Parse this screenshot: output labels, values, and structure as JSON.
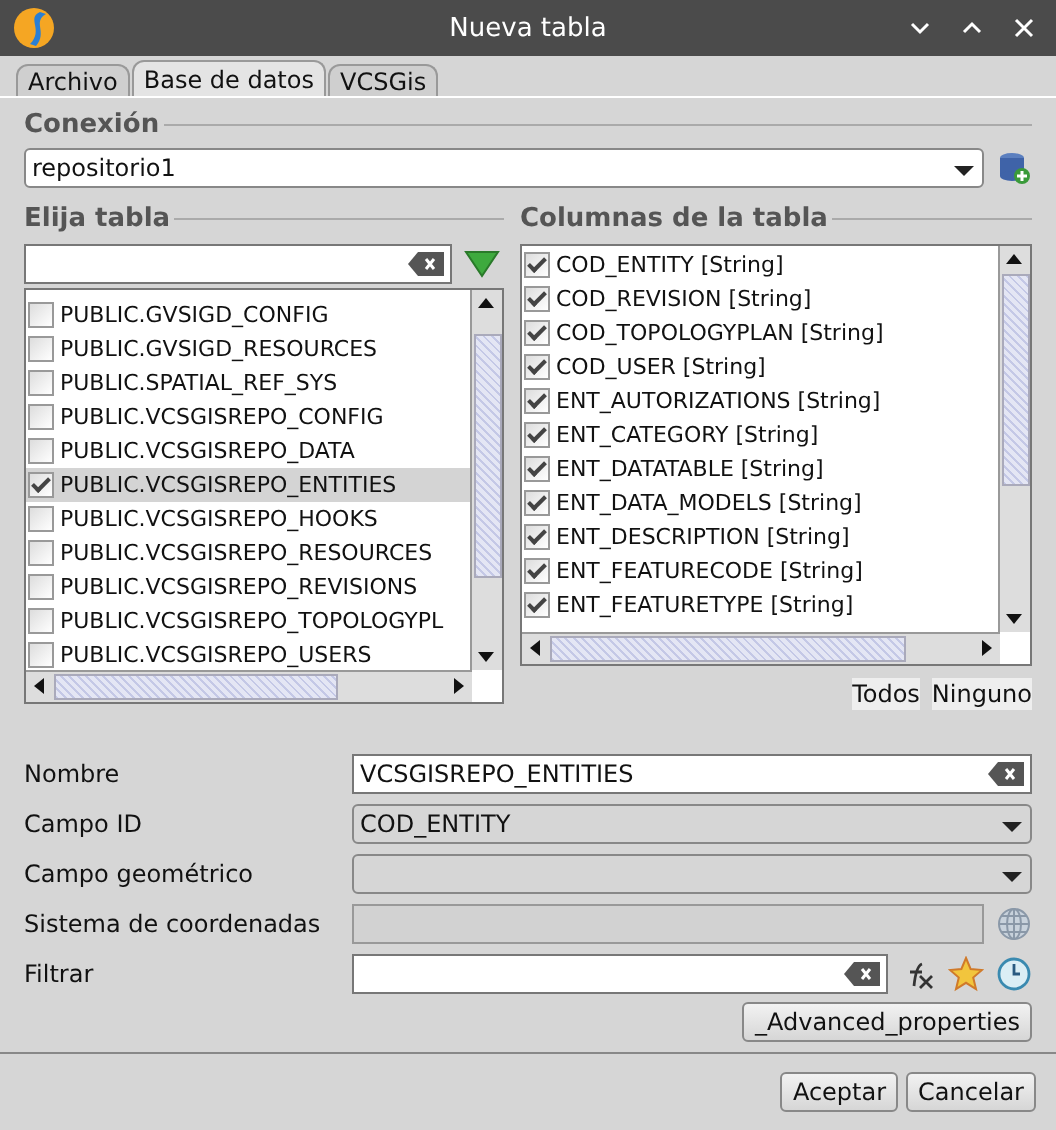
{
  "window": {
    "title": "Nueva tabla"
  },
  "tabs": [
    {
      "label": "Archivo",
      "selected": false
    },
    {
      "label": "Base de datos",
      "selected": true
    },
    {
      "label": "VCSGis",
      "selected": false
    }
  ],
  "connection": {
    "heading": "Conexión",
    "value": "repositorio1"
  },
  "tables": {
    "heading": "Elija tabla",
    "items": [
      {
        "label": "PUBLIC.GVSIGD_CONFIG",
        "checked": false,
        "selected": false
      },
      {
        "label": "PUBLIC.GVSIGD_RESOURCES",
        "checked": false,
        "selected": false
      },
      {
        "label": "PUBLIC.SPATIAL_REF_SYS",
        "checked": false,
        "selected": false
      },
      {
        "label": "PUBLIC.VCSGISREPO_CONFIG",
        "checked": false,
        "selected": false
      },
      {
        "label": "PUBLIC.VCSGISREPO_DATA",
        "checked": false,
        "selected": false
      },
      {
        "label": "PUBLIC.VCSGISREPO_ENTITIES",
        "checked": true,
        "selected": true
      },
      {
        "label": "PUBLIC.VCSGISREPO_HOOKS",
        "checked": false,
        "selected": false
      },
      {
        "label": "PUBLIC.VCSGISREPO_RESOURCES",
        "checked": false,
        "selected": false
      },
      {
        "label": "PUBLIC.VCSGISREPO_REVISIONS",
        "checked": false,
        "selected": false
      },
      {
        "label": "PUBLIC.VCSGISREPO_TOPOLOGYPL",
        "checked": false,
        "selected": false
      },
      {
        "label": "PUBLIC.VCSGISREPO_USERS",
        "checked": false,
        "selected": false
      }
    ]
  },
  "columns": {
    "heading": "Columnas de la tabla",
    "items": [
      {
        "label": "COD_ENTITY [String]",
        "checked": true
      },
      {
        "label": "COD_REVISION [String]",
        "checked": true
      },
      {
        "label": "COD_TOPOLOGYPLAN [String]",
        "checked": true
      },
      {
        "label": "COD_USER [String]",
        "checked": true
      },
      {
        "label": "ENT_AUTORIZATIONS [String]",
        "checked": true
      },
      {
        "label": "ENT_CATEGORY [String]",
        "checked": true
      },
      {
        "label": "ENT_DATATABLE [String]",
        "checked": true
      },
      {
        "label": "ENT_DATA_MODELS [String]",
        "checked": true
      },
      {
        "label": "ENT_DESCRIPTION [String]",
        "checked": true
      },
      {
        "label": "ENT_FEATURECODE [String]",
        "checked": true
      },
      {
        "label": "ENT_FEATURETYPE [String]",
        "checked": true
      }
    ],
    "buttons": [
      "Todos",
      "Ninguno"
    ]
  },
  "form": [
    {
      "kind": "text",
      "label": "Nombre",
      "value": "VCSGISREPO_ENTITIES"
    },
    {
      "kind": "combo",
      "label": "Campo ID",
      "value": "COD_ENTITY"
    },
    {
      "kind": "combo",
      "label": "Campo geométrico"
    },
    {
      "kind": "disabled",
      "label": "Sistema de coordenadas"
    },
    {
      "kind": "filter",
      "label": "Filtrar"
    }
  ],
  "advanced_button": "_Advanced_properties",
  "buttons": [
    "Aceptar",
    "Cancelar"
  ]
}
